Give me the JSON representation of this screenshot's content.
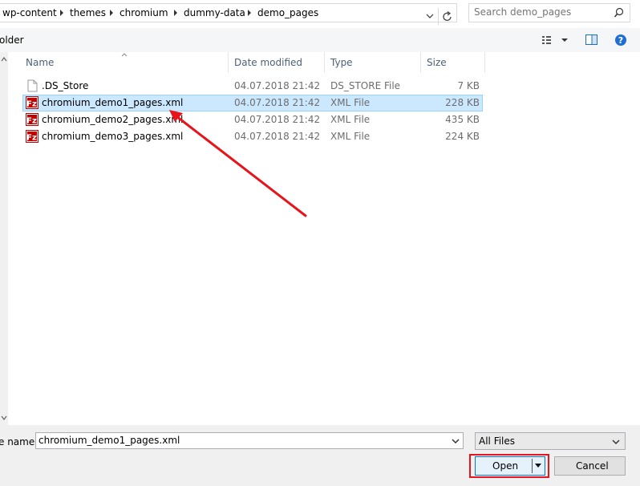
{
  "breadcrumb": [
    "wp-content",
    "themes",
    "chromium",
    "dummy-data",
    "demo_pages"
  ],
  "search": {
    "placeholder": "Search demo_pages"
  },
  "toolbar": {
    "new_folder_label": "older"
  },
  "columns": {
    "name": "Name",
    "date": "Date modified",
    "type": "Type",
    "size": "Size"
  },
  "files": [
    {
      "name": ".DS_Store",
      "date": "04.07.2018 21:42",
      "type": "DS_STORE File",
      "size": "7 KB",
      "icon": "generic-file-icon"
    },
    {
      "name": "chromium_demo1_pages.xml",
      "date": "04.07.2018 21:42",
      "type": "XML File",
      "size": "228 KB",
      "icon": "filezilla-xml-icon",
      "selected": true
    },
    {
      "name": "chromium_demo2_pages.xml",
      "date": "04.07.2018 21:42",
      "type": "XML File",
      "size": "435 KB",
      "icon": "filezilla-xml-icon"
    },
    {
      "name": "chromium_demo3_pages.xml",
      "date": "04.07.2018 21:42",
      "type": "XML File",
      "size": "224 KB",
      "icon": "filezilla-xml-icon"
    }
  ],
  "bottom": {
    "filename_label": "e name:",
    "filename_value": "chromium_demo1_pages.xml",
    "filter_value": "All Files",
    "open_label": "Open",
    "cancel_label": "Cancel"
  },
  "colors": {
    "selection": "#cce8ff",
    "annotation": "#e8141b",
    "filezilla": "#bf0000"
  }
}
